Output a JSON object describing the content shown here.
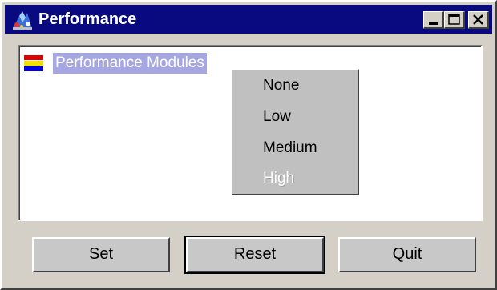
{
  "window": {
    "title": "Performance",
    "colors": {
      "titlebar": "#0a0a80",
      "face": "#d4d0c8",
      "selection": "#a6a6e0"
    }
  },
  "titlebar_buttons": {
    "minimize_icon": "minimize-icon",
    "maximize_icon": "maximize-icon",
    "close_icon": "close-icon"
  },
  "tree": {
    "node": {
      "label": "Performance Modules",
      "icon": "tricolor-flag-icon",
      "selected": true
    }
  },
  "context_menu": {
    "items": [
      {
        "label": "None",
        "enabled": true
      },
      {
        "label": "Low",
        "enabled": true
      },
      {
        "label": "Medium",
        "enabled": true
      },
      {
        "label": "High",
        "enabled": false
      }
    ]
  },
  "buttons": {
    "set": "Set",
    "reset": "Reset",
    "quit": "Quit"
  }
}
